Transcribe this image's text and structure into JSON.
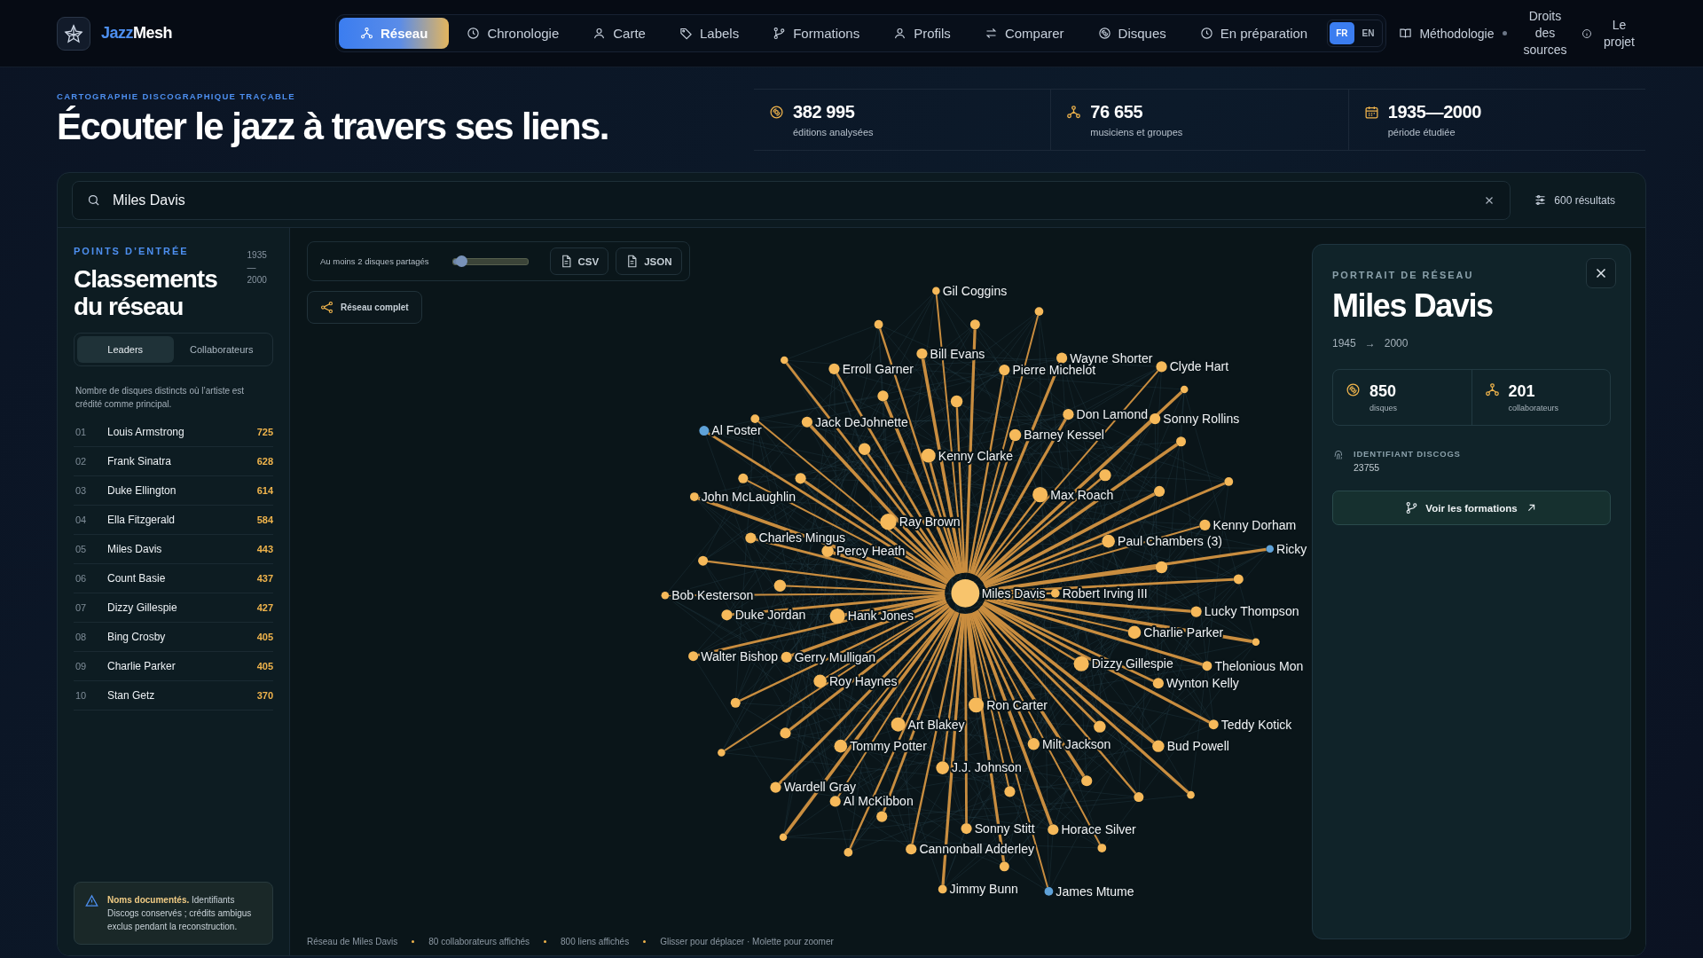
{
  "nav": {
    "logo": {
      "prefix": "Jazz",
      "suffix": "Mesh"
    },
    "tabs": [
      {
        "label": "Réseau",
        "selected": true
      },
      {
        "label": "Chronologie",
        "selected": false
      },
      {
        "label": "Carte",
        "selected": false
      },
      {
        "label": "Labels",
        "selected": false
      },
      {
        "label": "Formations",
        "selected": false
      },
      {
        "label": "Profils",
        "selected": false
      },
      {
        "label": "Comparer",
        "selected": false
      },
      {
        "label": "Disques",
        "selected": false
      },
      {
        "label": "En préparation",
        "selected": false
      }
    ],
    "languages": [
      {
        "label": "FR",
        "selected": true
      },
      {
        "label": "EN",
        "selected": false
      }
    ],
    "links": [
      "Méthodologie",
      "Droits des sources",
      "Le projet"
    ]
  },
  "header": {
    "eyebrow": "CARTOGRAPHIE DISCOGRAPHIQUE TRAÇABLE",
    "title": "Écouter le jazz à travers ses liens.",
    "stats": [
      {
        "value": "382 995",
        "label": "éditions analysées"
      },
      {
        "value": "76 655",
        "label": "musiciens et groupes"
      },
      {
        "value": "1935—2000",
        "label": "période étudiée"
      }
    ]
  },
  "search": {
    "value": "Miles Davis",
    "result_count": "600 résultats"
  },
  "sidebar": {
    "eyebrow": "POINTS D’ENTRÉE",
    "period": "1935—2000",
    "title": "Classements du réseau",
    "tabs": [
      {
        "label": "Leaders",
        "selected": true
      },
      {
        "label": "Collaborateurs",
        "selected": false
      }
    ],
    "description": "Nombre de disques distincts où l’artiste est crédité comme principal.",
    "rankings": [
      {
        "rank": "01",
        "name": "Louis Armstrong",
        "count": "725"
      },
      {
        "rank": "02",
        "name": "Frank Sinatra",
        "count": "628"
      },
      {
        "rank": "03",
        "name": "Duke Ellington",
        "count": "614"
      },
      {
        "rank": "04",
        "name": "Ella Fitzgerald",
        "count": "584"
      },
      {
        "rank": "05",
        "name": "Miles Davis",
        "count": "443"
      },
      {
        "rank": "06",
        "name": "Count Basie",
        "count": "437"
      },
      {
        "rank": "07",
        "name": "Dizzy Gillespie",
        "count": "427"
      },
      {
        "rank": "08",
        "name": "Bing Crosby",
        "count": "405"
      },
      {
        "rank": "09",
        "name": "Charlie Parker",
        "count": "405"
      },
      {
        "rank": "10",
        "name": "Stan Getz",
        "count": "370"
      }
    ],
    "note": "**Noms documentés.** Identifiants Discogs conservés ; crédits ambigus exclus pendant la reconstruction."
  },
  "graph": {
    "threshold_label": "Au moins 2 disques partagés",
    "slider": {
      "level": 0.12
    },
    "exports": [
      "CSV",
      "JSON"
    ],
    "reset_label": "Réseau complet",
    "center": {
      "label": "Miles Davis",
      "color": "#f8c46c"
    },
    "nodes": [
      {
        "label": "Gil Coggins",
        "color": "#f6b95a"
      },
      {
        "label": "Erroll Garner",
        "color": "#f6b95a"
      },
      {
        "label": "Bill Evans",
        "color": "#f6b95a"
      },
      {
        "label": "Pierre Michelot",
        "color": "#f6b95a"
      },
      {
        "label": "Wayne Shorter",
        "color": "#f6b95a"
      },
      {
        "label": "Clyde Hart",
        "color": "#f6b95a"
      },
      {
        "label": "Al Foster",
        "color": "#5fa2d8"
      },
      {
        "label": "Jack DeJohnette",
        "color": "#f6b95a"
      },
      {
        "label": "Barney Kessel",
        "color": "#f6b95a"
      },
      {
        "label": "Don Lamond",
        "color": "#f6b95a"
      },
      {
        "label": "Sonny Rollins",
        "color": "#f6b95a"
      },
      {
        "label": "Kenny Clarke",
        "color": "#f6b95a"
      },
      {
        "label": "John McLaughlin",
        "color": "#f6b95a"
      },
      {
        "label": "Max Roach",
        "color": "#f6b95a"
      },
      {
        "label": "Ray Brown",
        "color": "#f6b95a"
      },
      {
        "label": "Kenny Dorham",
        "color": "#f6b95a"
      },
      {
        "label": "Charles Mingus",
        "color": "#f6b95a"
      },
      {
        "label": "Percy Heath",
        "color": "#f6b95a"
      },
      {
        "label": "Paul Chambers (3)",
        "color": "#f6b95a"
      },
      {
        "label": "Ricky",
        "color": "#5fa2d8"
      },
      {
        "label": "Bob Kesterson",
        "color": "#f6b95a"
      },
      {
        "label": "Duke Jordan",
        "color": "#f6b95a"
      },
      {
        "label": "Hank Jones",
        "color": "#f6b95a"
      },
      {
        "label": "Robert Irving III",
        "color": "#f6b95a"
      },
      {
        "label": "Lucky Thompson",
        "color": "#f6b95a"
      },
      {
        "label": "Charlie Parker",
        "color": "#f6b95a"
      },
      {
        "label": "Walter Bishop",
        "color": "#f6b95a"
      },
      {
        "label": "Gerry Mulligan",
        "color": "#f6b95a"
      },
      {
        "label": "Dizzy Gillespie",
        "color": "#f6b95a"
      },
      {
        "label": "Thelonious Mon",
        "color": "#f6b95a"
      },
      {
        "label": "Roy Haynes",
        "color": "#f6b95a"
      },
      {
        "label": "Wynton Kelly",
        "color": "#f6b95a"
      },
      {
        "label": "Ron Carter",
        "color": "#f6b95a"
      },
      {
        "label": "Art Blakey",
        "color": "#f6b95a"
      },
      {
        "label": "Teddy Kotick",
        "color": "#f6b95a"
      },
      {
        "label": "Tommy Potter",
        "color": "#f6b95a"
      },
      {
        "label": "Milt Jackson",
        "color": "#f6b95a"
      },
      {
        "label": "Bud Powell",
        "color": "#f6b95a"
      },
      {
        "label": "J.J. Johnson",
        "color": "#f6b95a"
      },
      {
        "label": "Wardell Gray",
        "color": "#f6b95a"
      },
      {
        "label": "Al McKibbon",
        "color": "#f6b95a"
      },
      {
        "label": "Sonny Stitt",
        "color": "#f6b95a"
      },
      {
        "label": "Horace Silver",
        "color": "#f6b95a"
      },
      {
        "label": "Cannonball Adderley",
        "color": "#f6b95a"
      },
      {
        "label": "Jimmy Bunn",
        "color": "#f6b95a"
      },
      {
        "label": "James Mtume",
        "color": "#5fa2d8"
      }
    ],
    "footer": [
      "Réseau de Miles Davis",
      "80 collaborateurs affichés",
      "800 liens affichés",
      "Glisser pour déplacer · Molette pour zoomer"
    ]
  },
  "portrait": {
    "eyebrow": "PORTRAIT DE RÉSEAU",
    "name": "Miles Davis",
    "start": "1945",
    "arrow": "→",
    "end": "2000",
    "stats": [
      {
        "value": "850",
        "label": "disques"
      },
      {
        "value": "201",
        "label": "collaborateurs"
      }
    ],
    "id_label": "IDENTIFIANT DISCOGS",
    "id_value": "23755",
    "button": "Voir les formations"
  }
}
